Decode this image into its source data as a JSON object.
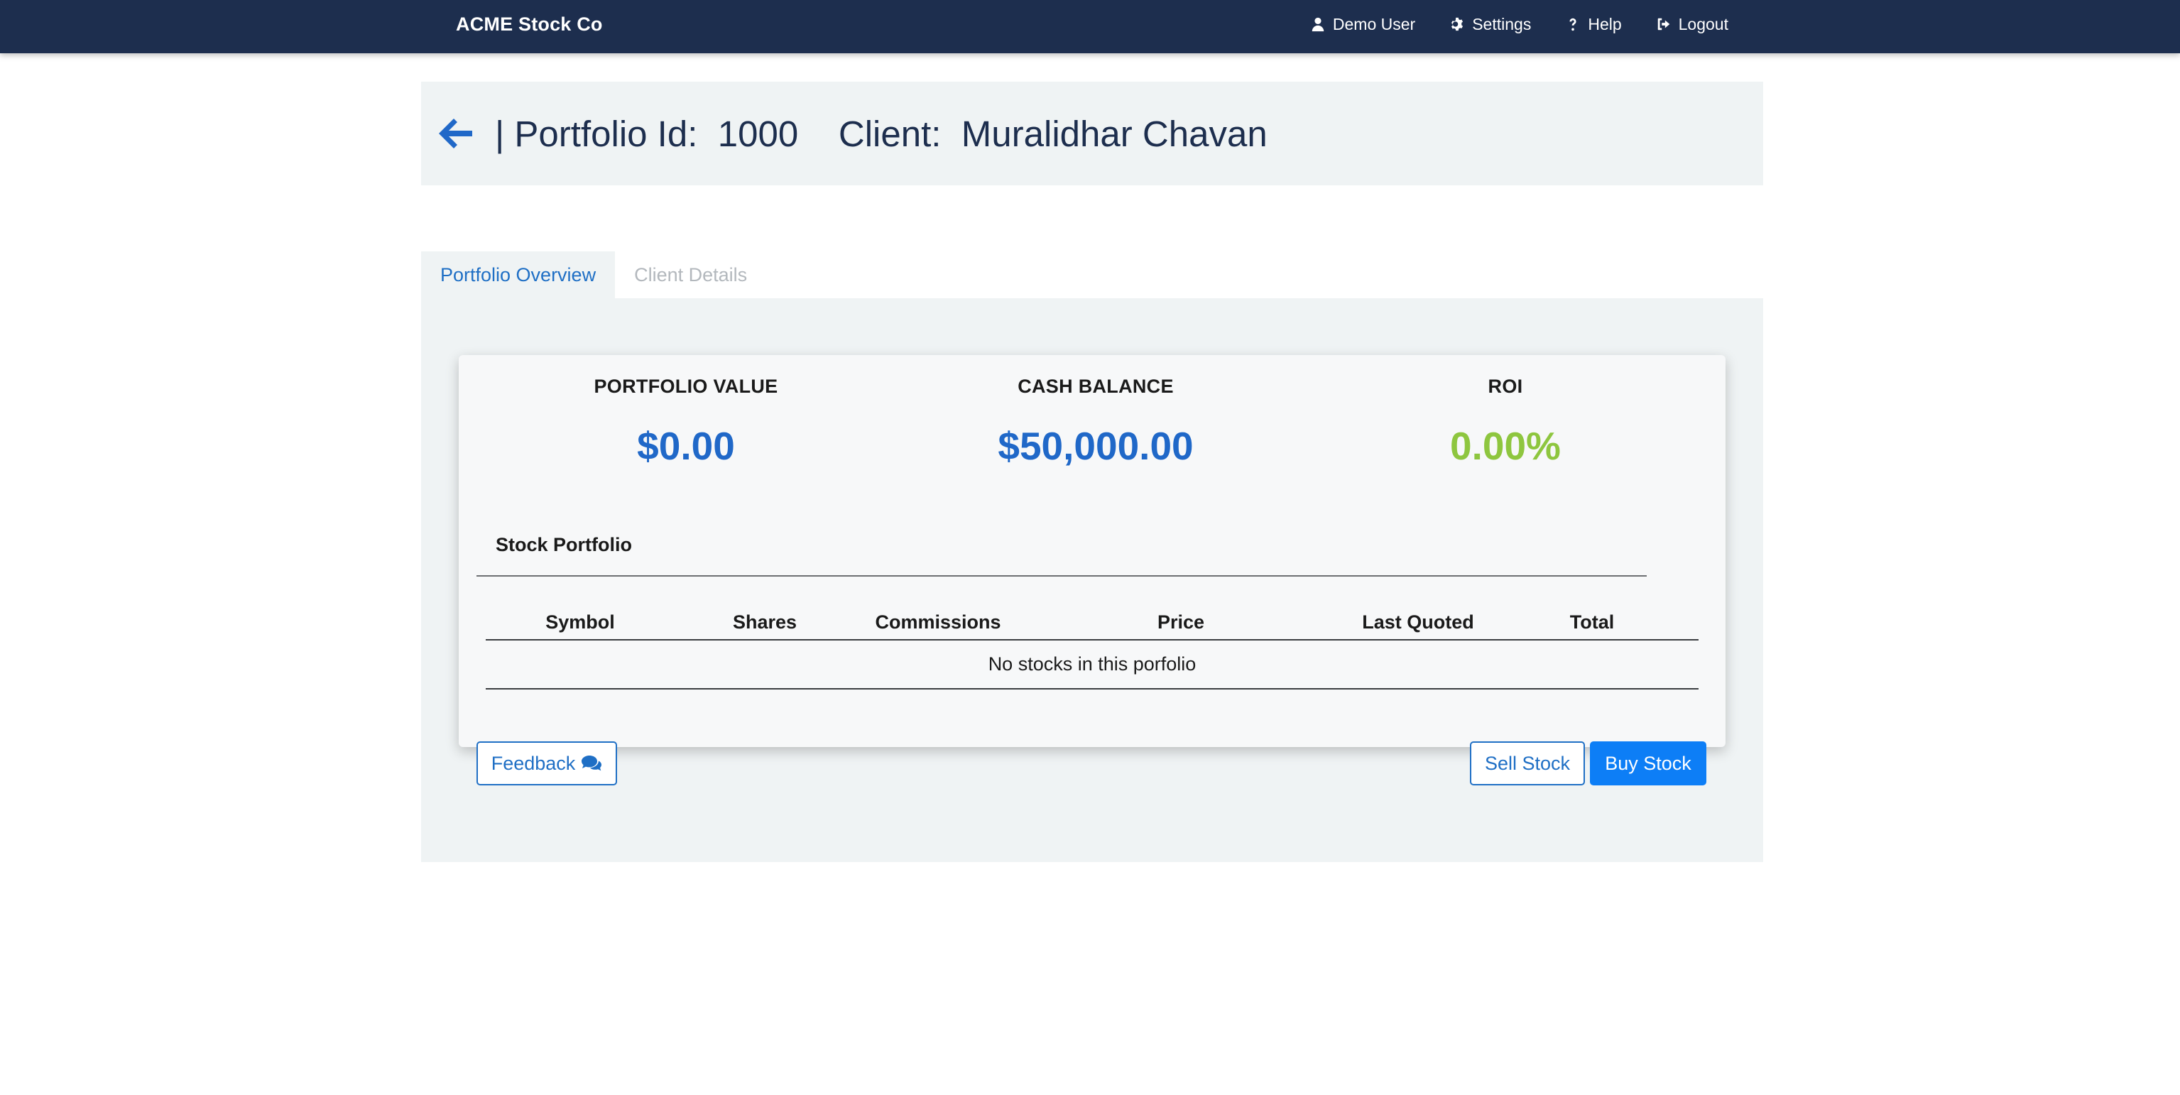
{
  "navbar": {
    "brand": "ACME Stock Co",
    "items": [
      {
        "label": "Demo User",
        "icon": "user-icon"
      },
      {
        "label": "Settings",
        "icon": "gear-icon"
      },
      {
        "label": "Help",
        "icon": "question-icon"
      },
      {
        "label": "Logout",
        "icon": "logout-icon"
      }
    ]
  },
  "header": {
    "portfolio_label": "| Portfolio Id:",
    "portfolio_id": "1000",
    "client_label": "Client:",
    "client_name": "Muralidhar Chavan",
    "back_icon": "arrow-left-icon"
  },
  "tabs": [
    {
      "label": "Portfolio Overview",
      "active": true
    },
    {
      "label": "Client Details",
      "active": false
    }
  ],
  "stats": {
    "portfolio_value": {
      "label": "PORTFOLIO VALUE",
      "value": "$0.00"
    },
    "cash_balance": {
      "label": "CASH BALANCE",
      "value": "$50,000.00"
    },
    "roi": {
      "label": "ROI",
      "value": "0.00%"
    }
  },
  "stock_portfolio": {
    "title": "Stock Portfolio",
    "columns": [
      "Symbol",
      "Shares",
      "Commissions",
      "Price",
      "Last Quoted",
      "Total"
    ],
    "empty_message": "No stocks in this porfolio"
  },
  "actions": {
    "feedback": "Feedback",
    "sell": "Sell Stock",
    "buy": "Buy Stock"
  },
  "colors": {
    "navbar": "#1d2e4e",
    "accent": "#2068c8",
    "roi_green": "#8ec63f",
    "primary_button": "#0d7ef6"
  }
}
